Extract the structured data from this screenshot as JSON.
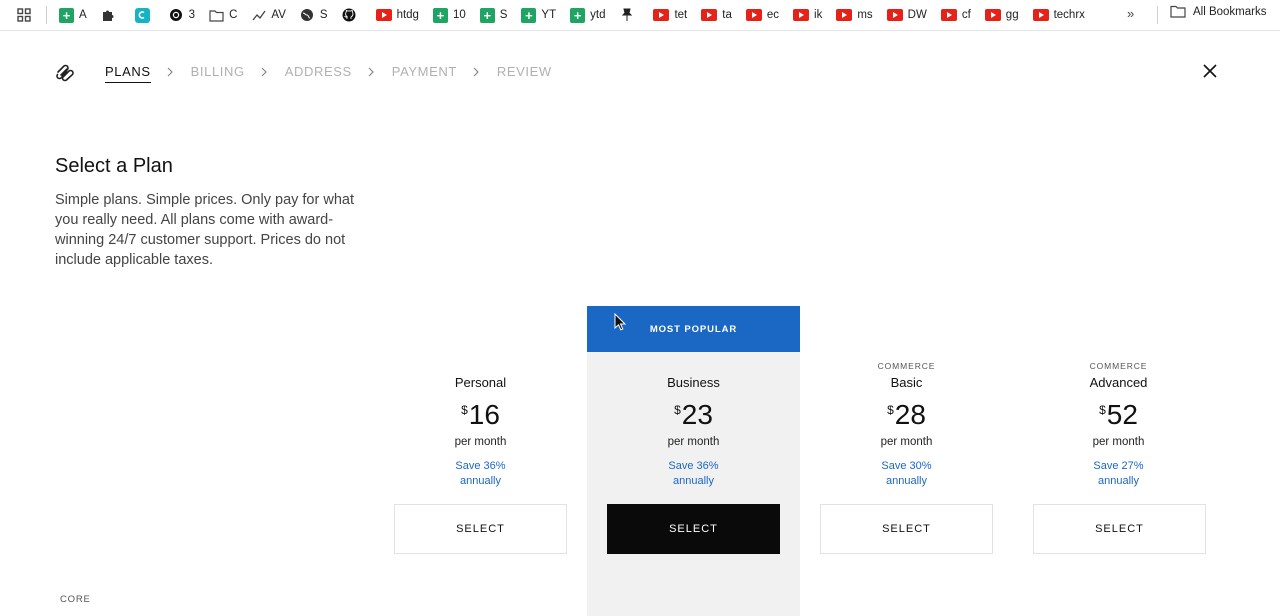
{
  "bookmarks": {
    "items": [
      {
        "icon": "sheets-icon",
        "label": "A"
      },
      {
        "icon": "puzzle-icon",
        "label": ""
      },
      {
        "icon": "app-icon",
        "label": ""
      },
      {
        "icon": "threads-icon",
        "label": "3"
      },
      {
        "icon": "folder-icon",
        "label": "C"
      },
      {
        "icon": "trend-icon",
        "label": "AV"
      },
      {
        "icon": "globe-icon",
        "label": "S"
      },
      {
        "icon": "github-icon",
        "label": ""
      },
      {
        "icon": "youtube-icon",
        "label": "htdg"
      },
      {
        "icon": "sheets-icon",
        "label": "10"
      },
      {
        "icon": "sheets-icon",
        "label": "S"
      },
      {
        "icon": "sheets-icon",
        "label": "YT"
      },
      {
        "icon": "sheets-icon",
        "label": "ytd"
      },
      {
        "icon": "pin-icon",
        "label": ""
      },
      {
        "icon": "youtube-icon",
        "label": "tet"
      },
      {
        "icon": "youtube-icon",
        "label": "ta"
      },
      {
        "icon": "youtube-icon",
        "label": "ec"
      },
      {
        "icon": "youtube-icon",
        "label": "ik"
      },
      {
        "icon": "youtube-icon",
        "label": "ms"
      },
      {
        "icon": "youtube-icon",
        "label": "DW"
      },
      {
        "icon": "youtube-icon",
        "label": "cf"
      },
      {
        "icon": "youtube-icon",
        "label": "gg"
      },
      {
        "icon": "youtube-icon",
        "label": "techrx"
      }
    ],
    "more": "»",
    "all_bookmarks": "All Bookmarks"
  },
  "steps": [
    "PLANS",
    "BILLING",
    "ADDRESS",
    "PAYMENT",
    "REVIEW"
  ],
  "active_step": "PLANS",
  "intro": {
    "title": "Select a Plan",
    "description": "Simple plans. Simple prices. Only pay for what you really need. All plans come with award-winning 24/7 customer support. Prices do not include applicable taxes."
  },
  "popular_badge": "MOST POPULAR",
  "plans": [
    {
      "kicker": "",
      "name": "Personal",
      "currency": "$",
      "price": "16",
      "period": "per month",
      "save_line1": "Save 36%",
      "save_line2": "annually",
      "button": "SELECT"
    },
    {
      "kicker": "",
      "name": "Business",
      "currency": "$",
      "price": "23",
      "period": "per month",
      "save_line1": "Save 36%",
      "save_line2": "annually",
      "button": "SELECT"
    },
    {
      "kicker": "COMMERCE",
      "name": "Basic",
      "currency": "$",
      "price": "28",
      "period": "per month",
      "save_line1": "Save 30%",
      "save_line2": "annually",
      "button": "SELECT"
    },
    {
      "kicker": "COMMERCE",
      "name": "Advanced",
      "currency": "$",
      "price": "52",
      "period": "per month",
      "save_line1": "Save 27%",
      "save_line2": "annually",
      "button": "SELECT"
    }
  ],
  "section_label": "CORE",
  "colors": {
    "accent": "#1b67c4",
    "popular_bg": "#f1f1f1",
    "dark_button": "#0a0a0a"
  }
}
